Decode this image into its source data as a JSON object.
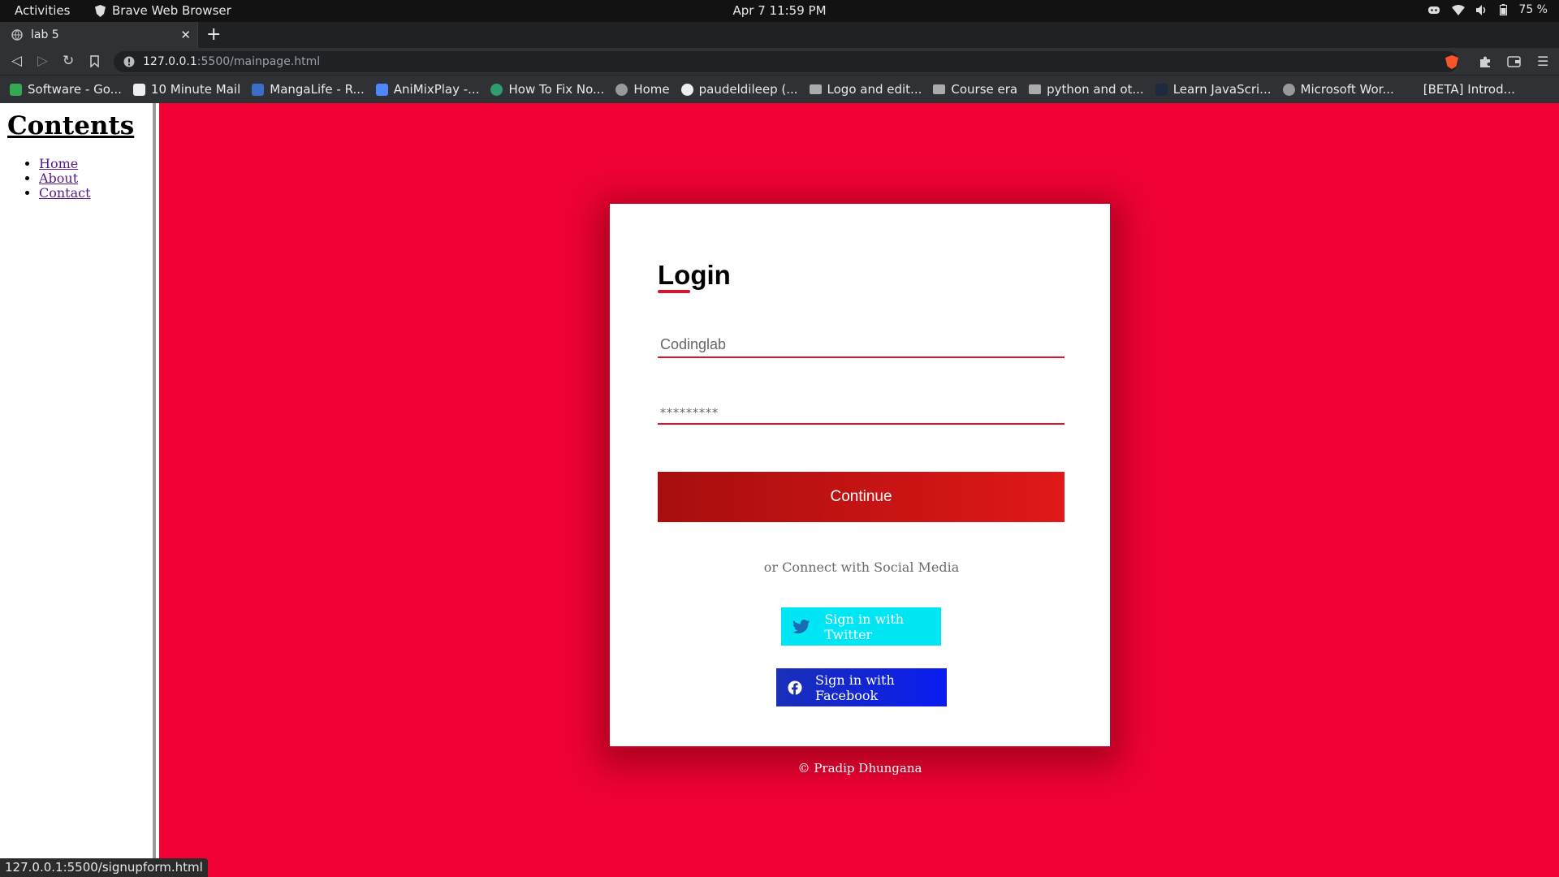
{
  "system": {
    "activities": "Activities",
    "app_name": "Brave Web Browser",
    "clock": "Apr 7  11:59 PM",
    "battery": "75 %"
  },
  "browser": {
    "tab_title": "lab 5",
    "url_host": "127.0.0.1",
    "url_path": ":5500/mainpage.html",
    "bookmarks": [
      "Software - Go...",
      "10 Minute Mail",
      "MangaLife - R...",
      "AniMixPlay -...",
      "How To Fix No...",
      "Home",
      "paudeldileep (...",
      "Logo and edit...",
      "Course era",
      "python and ot...",
      "Learn JavaScri...",
      "Microsoft Wor...",
      "[BETA] Introd..."
    ],
    "status_url": "127.0.0.1:5500/signupform.html"
  },
  "sidebar": {
    "title": "Contents",
    "links": [
      "Home",
      "About",
      "Contact"
    ]
  },
  "login": {
    "title": "Login",
    "username_placeholder": "Codinglab",
    "password_placeholder": "*********",
    "continue_label": "Continue",
    "social_text": "or Connect with Social Media",
    "twitter_label": "Sign in with Twitter",
    "facebook_label": "Sign in with Facebook",
    "copyright": "© Pradip Dhungana"
  },
  "colors": {
    "background": "#f00236",
    "accent": "#e0112e",
    "twitter": "#00e6f4",
    "facebook": "#0a1cf0"
  }
}
